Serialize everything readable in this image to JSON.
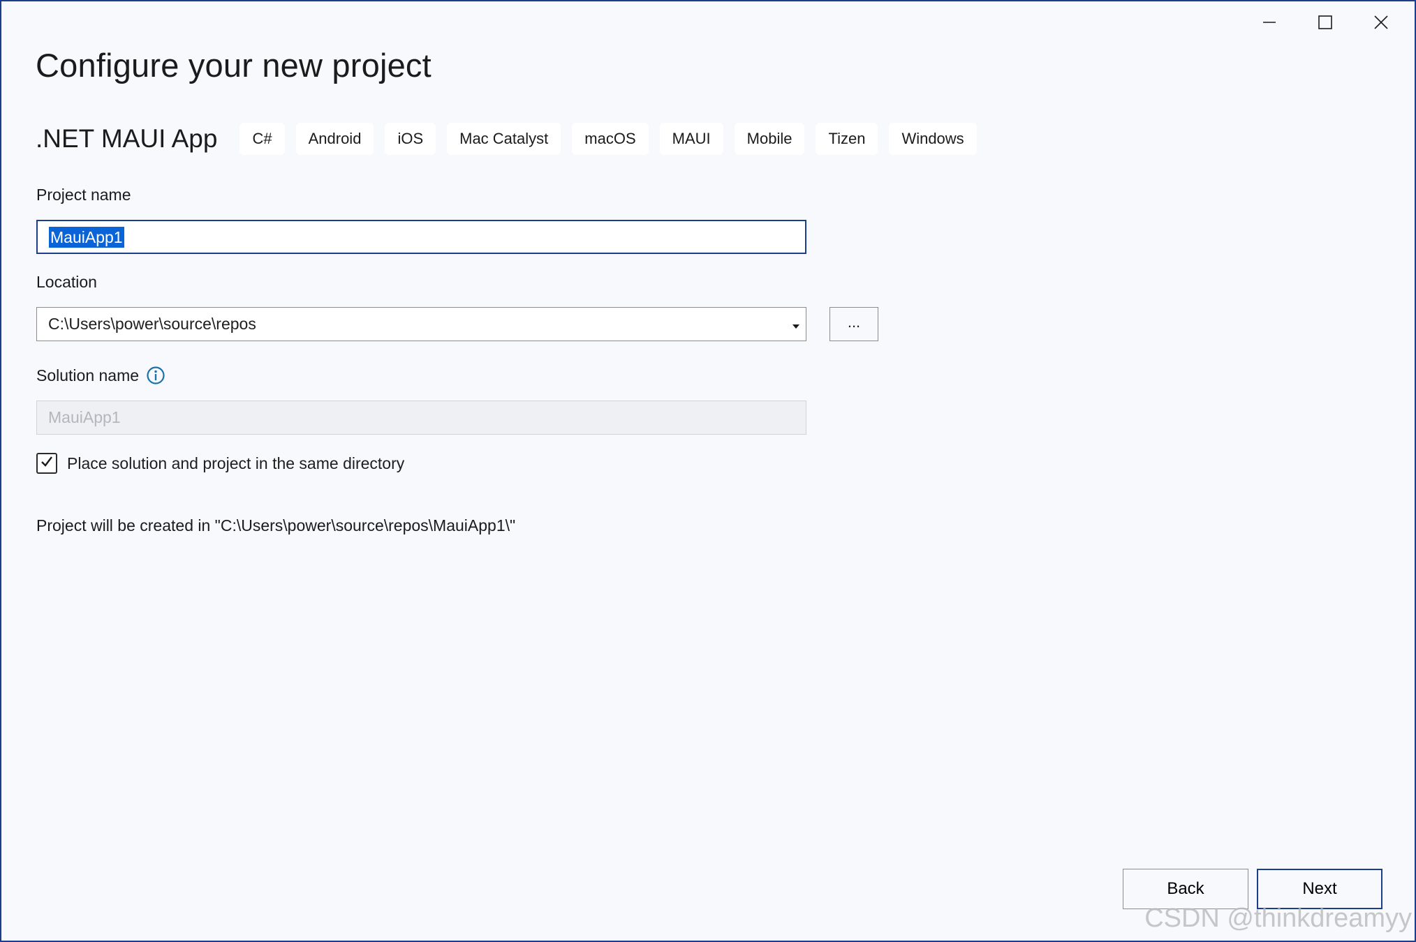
{
  "window": {
    "controls": [
      "minimize",
      "maximize",
      "close"
    ]
  },
  "header": {
    "title": "Configure your new project"
  },
  "template": {
    "name": ".NET MAUI App",
    "tags": [
      "C#",
      "Android",
      "iOS",
      "Mac Catalyst",
      "macOS",
      "MAUI",
      "Mobile",
      "Tizen",
      "Windows"
    ]
  },
  "form": {
    "project_name_label": "Project name",
    "project_name_value": "MauiApp1",
    "location_label": "Location",
    "location_value": "C:\\Users\\power\\source\\repos",
    "browse_label": "...",
    "solution_name_label": "Solution name",
    "solution_name_value": "MauiApp1",
    "same_directory_label": "Place solution and project in the same directory",
    "same_directory_checked": true,
    "created_in_text": "Project will be created in \"C:\\Users\\power\\source\\repos\\MauiApp1\\\""
  },
  "footer": {
    "back_label": "Back",
    "next_label": "Next"
  },
  "watermark": "CSDN @thinkdreamyy",
  "colors": {
    "accent": "#1c3d8a",
    "selection": "#0a64d8",
    "info_icon": "#1a73a8",
    "background": "#f8f9fd"
  }
}
